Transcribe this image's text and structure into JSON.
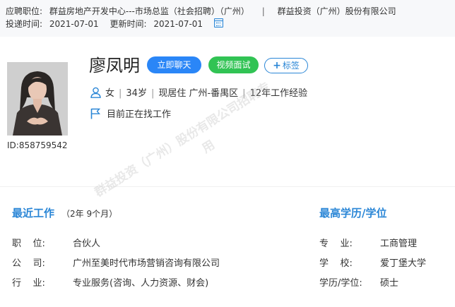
{
  "header": {
    "position_label": "应聘职位:",
    "position_value": "群益房地产开发中心---市场总监（社会招聘）（广州）",
    "separator": "|",
    "company": "群益投资（广州）股份有限公司",
    "submit_label": "投递时间:",
    "submit_date": "2021-07-01",
    "update_label": "更新时间:",
    "update_date": "2021-07-01"
  },
  "profile": {
    "name": "廖凤明",
    "chat_button": "立即聊天",
    "video_button": "视频面试",
    "tag_button": "标签",
    "gender": "女",
    "age": "34岁",
    "residence": "现居住 广州-番禺区",
    "experience": "12年工作经验",
    "job_status": "目前正在找工作",
    "id": "ID:858759542"
  },
  "work": {
    "title": "最近工作",
    "duration": "（2年 9个月）",
    "position_label": "职    位:",
    "position_value": "合伙人",
    "company_label": "公    司:",
    "company_value": "广州至美时代市场营销咨询有限公司",
    "industry_label": "行    业:",
    "industry_value": "专业服务(咨询、人力资源、财会)"
  },
  "education": {
    "title": "最高学历/学位",
    "major_label": "专    业:",
    "major_value": "工商管理",
    "school_label": "学    校:",
    "school_value": "爱丁堡大学",
    "degree_label": "学历/学位:",
    "degree_value": "硕士"
  },
  "watermark": {
    "line1": "群益投资（广州）股份有限公司招聘专",
    "line2": "用"
  },
  "colors": {
    "accent": "#2a86d6",
    "chat_button": "#2a86f7",
    "video_button": "#31c354"
  }
}
